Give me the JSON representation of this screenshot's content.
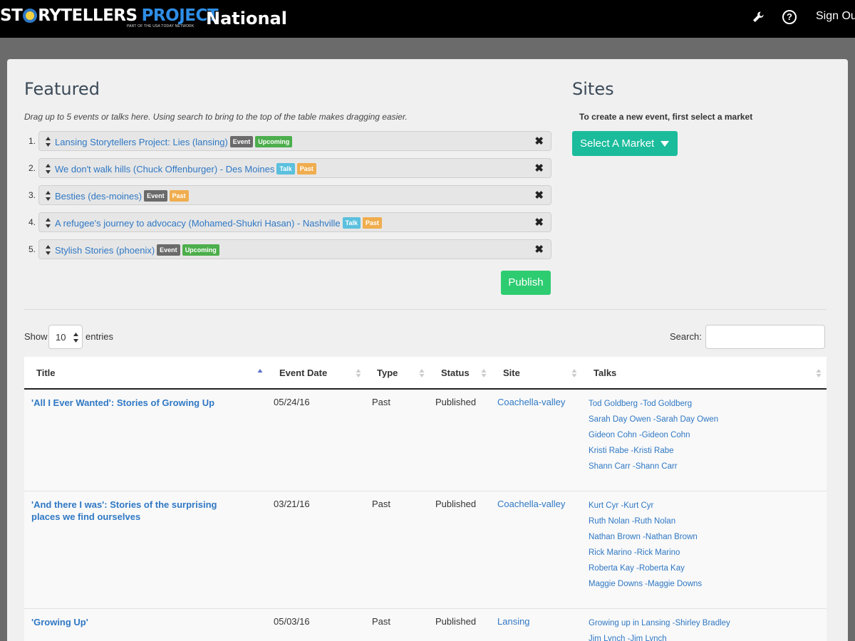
{
  "header": {
    "logo_text_a": "ST",
    "logo_text_b": "RYTELLERS",
    "logo_text_c": "PROJECT",
    "logo_subtitle": "PART OF THE USA TODAY NETWORK",
    "title": "National",
    "sign_out": "Sign Out"
  },
  "featured": {
    "heading": "Featured",
    "hint": "Drag up to 5 events or talks here. Using search to bring to the top of the table makes dragging easier.",
    "items": [
      {
        "num": "1.",
        "label": "Lansing Storytellers Project: Lies (lansing)",
        "badges": [
          "Event",
          "Upcoming"
        ]
      },
      {
        "num": "2.",
        "label": "We don't walk hills (Chuck Offenburger) - Des Moines",
        "badges": [
          "Talk",
          "Past"
        ]
      },
      {
        "num": "3.",
        "label": "Besties (des-moines)",
        "badges": [
          "Event",
          "Past"
        ]
      },
      {
        "num": "4.",
        "label": "A refugee's journey to advocacy (Mohamed-Shukri Hasan) - Nashville",
        "badges": [
          "Talk",
          "Past"
        ]
      },
      {
        "num": "5.",
        "label": "Stylish Stories (phoenix)",
        "badges": [
          "Event",
          "Upcoming"
        ]
      }
    ],
    "publish_label": "Publish"
  },
  "sites": {
    "heading": "Sites",
    "hint": "To create a new event, first select a market",
    "select_label": "Select A Market"
  },
  "table_controls": {
    "show_label": "Show",
    "length_value": "10",
    "entries_label": "entries",
    "search_label": "Search:"
  },
  "table": {
    "columns": [
      "Title",
      "Event Date",
      "Type",
      "Status",
      "Site",
      "Talks"
    ],
    "rows": [
      {
        "title": "'All I Ever Wanted': Stories of Growing Up",
        "date": "05/24/16",
        "type": "Past",
        "status": "Published",
        "site": "Coachella-valley",
        "talks": [
          "Tod Goldberg -Tod Goldberg",
          "Sarah Day Owen -Sarah Day Owen",
          "Gideon Cohn -Gideon Cohn",
          "Kristi Rabe -Kristi Rabe",
          "Shann Carr -Shann Carr"
        ]
      },
      {
        "title": "'And there I was': Stories of the surprising places we find ourselves",
        "date": "03/21/16",
        "type": "Past",
        "status": "Published",
        "site": "Coachella-valley",
        "talks": [
          "Kurt Cyr -Kurt Cyr",
          "Ruth Nolan -Ruth Nolan",
          "Nathan Brown -Nathan Brown",
          "Rick Marino -Rick Marino",
          "Roberta Kay -Roberta Kay",
          "Maggie Downs -Maggie Downs"
        ]
      },
      {
        "title": "'Growing Up'",
        "date": "05/03/16",
        "type": "Past",
        "status": "Published",
        "site": "Lansing",
        "talks": [
          "Growing up in Lansing -Shirley Bradley",
          "Jim Lynch -Jim Lynch"
        ]
      }
    ]
  }
}
